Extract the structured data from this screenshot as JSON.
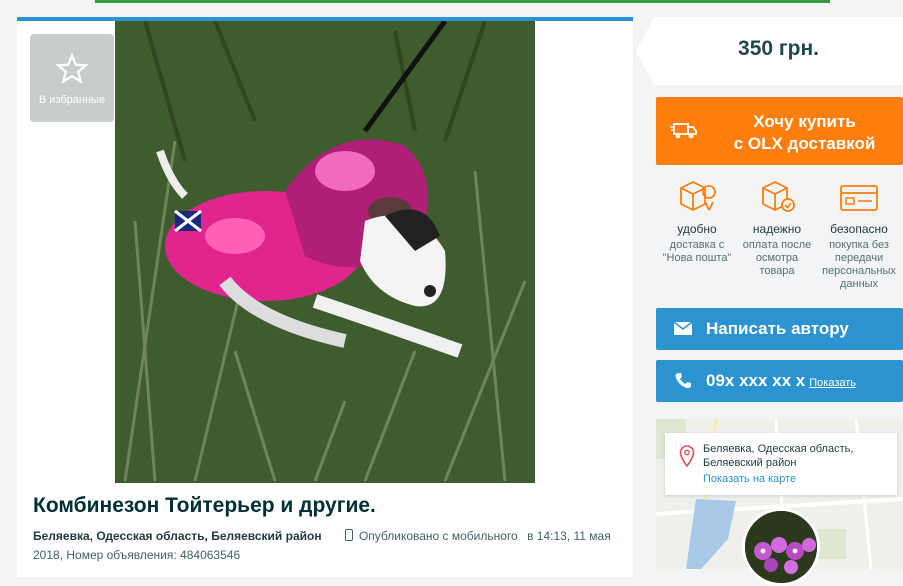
{
  "colors": {
    "accent_blue": "#2a93d0",
    "buy_orange": "#ff7e0e",
    "text_dark": "#002f34"
  },
  "favorite": {
    "label": "В избранные",
    "icon": "star-icon"
  },
  "ad": {
    "title": "Комбинезон Тойтерьер и другие.",
    "location": "Беляевка, Одесская область, Беляевский район",
    "published": "Опубликовано с мобильного",
    "time": "в 14:13, 11 мая 2018, Номер объявления: 484063546"
  },
  "price": "350 грн.",
  "buy": {
    "line1": "Хочу купить",
    "line2": "с OLX доставкой",
    "icon": "truck-icon"
  },
  "features": [
    {
      "title": "удобно",
      "desc": "доставка с \"Нова пошта\"",
      "icon": "box-location-icon"
    },
    {
      "title": "надежно",
      "desc": "оплата после осмотра товара",
      "icon": "box-check-icon"
    },
    {
      "title": "безопасно",
      "desc": "покупка без передачи персональных данных",
      "icon": "card-icon"
    }
  ],
  "contact": {
    "write_label": "Написать автору",
    "phone": "09x xxx xx x",
    "show_label": "Показать"
  },
  "map": {
    "address": "Беляевка, Одесская область, Беляевский район",
    "show_on_map": "Показать на карте"
  }
}
